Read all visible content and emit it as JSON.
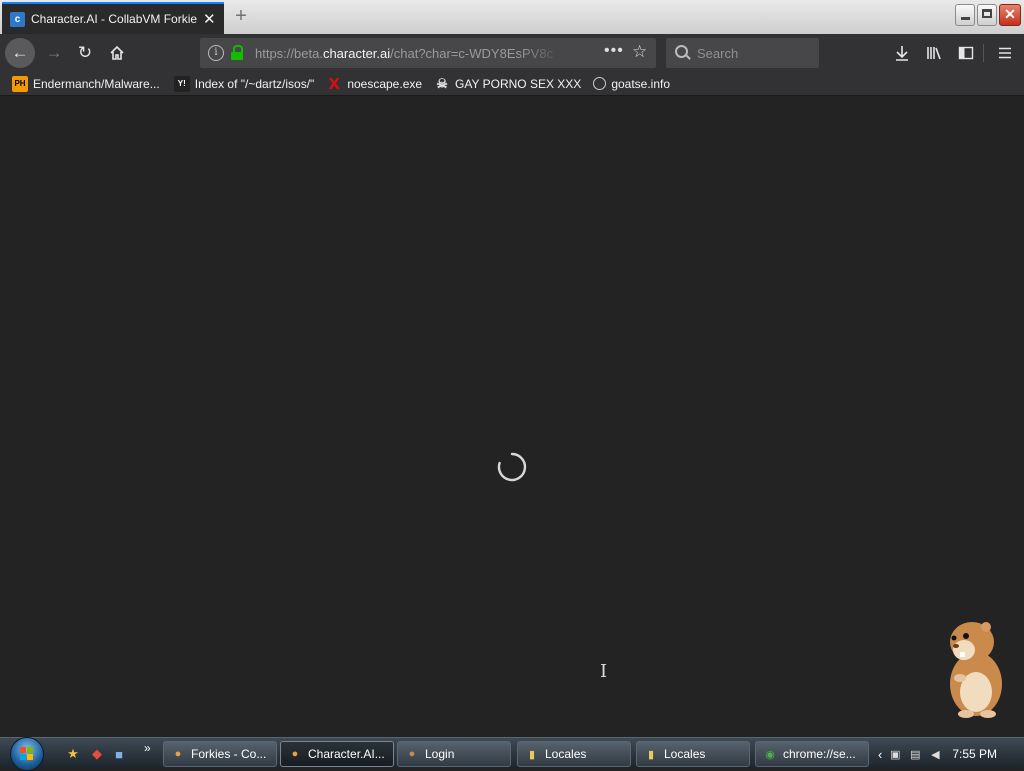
{
  "browser": {
    "active_tab": {
      "title": "Character.AI - CollabVM Forkie",
      "close_icon": "close-icon"
    },
    "new_tab_glyph": "+",
    "url": {
      "prefix": "https://beta.",
      "domain": "character.ai",
      "path": "/chat?char=c-WDY8EsPV8c"
    },
    "search_placeholder": "Search"
  },
  "bookmarks": [
    {
      "label": "Endermanch/Malware...",
      "icon_text": "PH"
    },
    {
      "label": "Index of \"/~dartz/isos/\"",
      "icon_text": "Y!"
    },
    {
      "label": "noescape.exe",
      "icon_text": "X"
    },
    {
      "label": "GAY PORNO SEX XXX",
      "icon_text": "☠"
    },
    {
      "label": "goatse.info",
      "icon_text": ""
    }
  ],
  "page": {
    "state": "loading"
  },
  "taskbar": {
    "tasks": [
      {
        "label": "Forkies - Co...",
        "icon": "firefox-icon",
        "active": false
      },
      {
        "label": "Character.AI...",
        "icon": "firefox-icon",
        "active": true
      },
      {
        "label": "Login",
        "icon": "app-icon",
        "active": false
      },
      {
        "label": "Locales",
        "icon": "folder-icon",
        "active": false
      },
      {
        "label": "Locales",
        "icon": "folder-icon",
        "active": false
      },
      {
        "label": "chrome://se...",
        "icon": "chrome-icon",
        "active": false
      }
    ],
    "clock": "7:55 PM"
  },
  "colors": {
    "accent": "#0a84ff",
    "lock": "#12bc00",
    "background": "#232323"
  }
}
